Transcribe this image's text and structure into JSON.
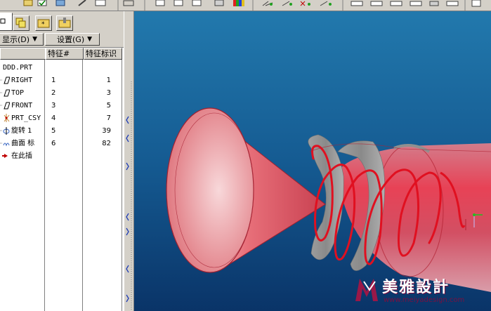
{
  "display_menu": {
    "label": "显示(D)",
    "arrow": "▼"
  },
  "settings_menu": {
    "label": "设置(G)",
    "arrow": "▼"
  },
  "columns": {
    "feature_num": "特征#",
    "feature_id": "特征标识"
  },
  "tree": {
    "root": "DDD.PRT",
    "items": [
      {
        "label": "RIGHT",
        "icon": "datum-plane-icon",
        "feature_num": "1",
        "feature_id": "1"
      },
      {
        "label": "TOP",
        "icon": "datum-plane-icon",
        "feature_num": "2",
        "feature_id": "3"
      },
      {
        "label": "FRONT",
        "icon": "datum-plane-icon",
        "feature_num": "3",
        "feature_id": "5"
      },
      {
        "label": "PRT_CSY",
        "icon": "coordinate-system-icon",
        "feature_num": "4",
        "feature_id": "7"
      },
      {
        "label": "旋转 1",
        "icon": "revolve-icon",
        "feature_num": "5",
        "feature_id": "39"
      },
      {
        "label": "曲面 标",
        "icon": "surface-icon",
        "feature_num": "6",
        "feature_id": "82"
      },
      {
        "label": "在此插",
        "icon": "insert-here-arrow-icon",
        "feature_num": "",
        "feature_id": ""
      }
    ]
  },
  "watermark": {
    "title": "美雅設計",
    "url": "www.meiyadesign.com"
  },
  "colors": {
    "viewport_top": "#1f74a8",
    "viewport_bottom": "#0b3a6e",
    "model": "#e0505a",
    "spiral": "#e01020",
    "accent_arrow": "#c00000"
  }
}
